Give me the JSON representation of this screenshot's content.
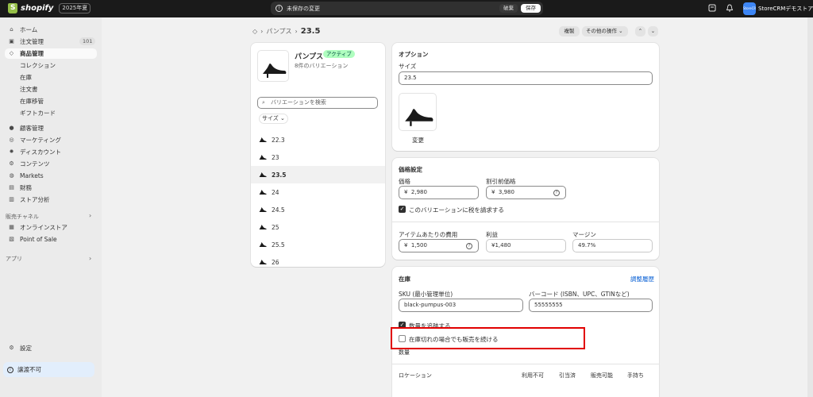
{
  "topbar": {
    "logo_text": "shopify",
    "edition": "2025年夏",
    "unsaved_message": "未保存の変更",
    "discard_label": "破棄",
    "save_label": "保存",
    "store_avatar_text": "StoreCRM",
    "store_name": "StoreCRMデモストア"
  },
  "sidebar": {
    "items": [
      {
        "label": "ホーム",
        "icon": "home-icon"
      },
      {
        "label": "注文管理",
        "icon": "inbox-icon",
        "badge": "101"
      },
      {
        "label": "商品管理",
        "icon": "tag-icon"
      },
      {
        "label": "コレクション"
      },
      {
        "label": "在庫"
      },
      {
        "label": "注文書"
      },
      {
        "label": "在庫移管"
      },
      {
        "label": "ギフトカード"
      },
      {
        "label": "顧客管理",
        "icon": "person-icon"
      },
      {
        "label": "マーケティング",
        "icon": "target-icon"
      },
      {
        "label": "ディスカウント",
        "icon": "discount-icon"
      },
      {
        "label": "コンテンツ",
        "icon": "content-icon"
      },
      {
        "label": "Markets",
        "icon": "globe-icon"
      },
      {
        "label": "財務",
        "icon": "bank-icon"
      },
      {
        "label": "ストア分析",
        "icon": "chart-icon"
      }
    ],
    "sales_channels_label": "販売チャネル",
    "channels": [
      {
        "label": "オンラインストア",
        "icon": "store-icon"
      },
      {
        "label": "Point of Sale",
        "icon": "pos-icon"
      }
    ],
    "apps_label": "アプリ",
    "settings_label": "設定",
    "non_transferable_label": "譲渡不可"
  },
  "header": {
    "breadcrumb_parent": "パンプス",
    "breadcrumb_current": "23.5",
    "duplicate_label": "複製",
    "more_actions_label": "その他の操作"
  },
  "product_card": {
    "title": "パンプス",
    "status": "アクティブ",
    "variant_count": "8件のバリエーション",
    "search_placeholder": "バリエーションを検索",
    "filter_label": "サイズ",
    "variants": [
      "22.3",
      "23",
      "23.5",
      "24",
      "24.5",
      "25",
      "25.5",
      "26"
    ],
    "selected_index": 2
  },
  "options": {
    "heading": "オプション",
    "size_label": "サイズ",
    "size_value": "23.5",
    "change_label": "変更"
  },
  "pricing": {
    "heading": "価格設定",
    "price_label": "価格",
    "price_value": "2,980",
    "compare_label": "割引前価格",
    "compare_value": "3,980",
    "currency": "¥",
    "tax_label": "このバリエーションに税を請求する",
    "cost_label": "アイテムあたりの費用",
    "cost_value": "1,500",
    "profit_label": "利益",
    "profit_value": "¥1,480",
    "margin_label": "マージン",
    "margin_value": "49.7%"
  },
  "inventory": {
    "heading": "在庫",
    "history_link": "調整履歴",
    "sku_label": "SKU (最小管理単位)",
    "sku_value": "black-pumpus-003",
    "barcode_label": "バーコード (ISBN、UPC、GTINなど)",
    "barcode_value": "55555555",
    "track_label": "数量を追跡する",
    "continue_selling_label": "在庫切れの場合でも販売を続ける",
    "quantity_label": "数量",
    "table_headers": [
      "ロケーション",
      "利用不可",
      "引当済",
      "販売可能",
      "手持ち"
    ]
  }
}
